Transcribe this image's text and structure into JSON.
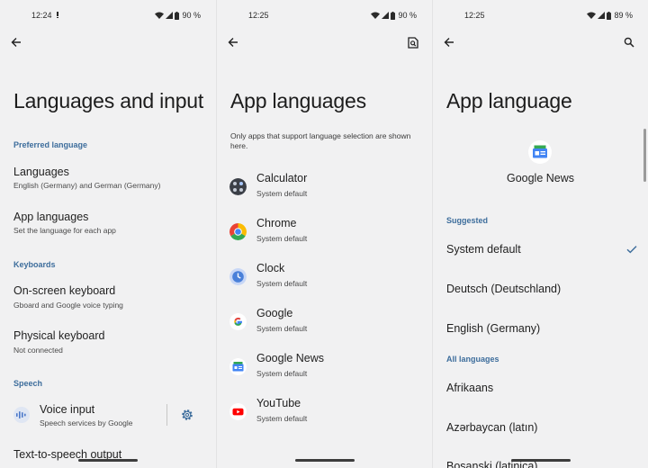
{
  "colors": {
    "accent": "#3d6d9c",
    "background": "#f1f1f2",
    "text": "#1f1f1f",
    "subtext": "#4a4a4a"
  },
  "screen1": {
    "status": {
      "time": "12:24",
      "battery": "90 %"
    },
    "title": "Languages and input",
    "preferred_header": "Preferred language",
    "languages": {
      "title": "Languages",
      "sub": "English (Germany) and German (Germany)"
    },
    "app_languages": {
      "title": "App languages",
      "sub": "Set the language for each app"
    },
    "keyboards_header": "Keyboards",
    "onscreen": {
      "title": "On-screen keyboard",
      "sub": "Gboard and Google voice typing"
    },
    "physical": {
      "title": "Physical keyboard",
      "sub": "Not connected"
    },
    "speech_header": "Speech",
    "voice_input": {
      "title": "Voice input",
      "sub": "Speech services by Google"
    },
    "tts": {
      "title": "Text-to-speech output"
    }
  },
  "screen2": {
    "status": {
      "time": "12:25",
      "battery": "90 %"
    },
    "title": "App languages",
    "description": "Only apps that support language selection are shown here.",
    "apps": [
      {
        "name": "Calculator",
        "sub": "System default",
        "icon": "calculator-icon"
      },
      {
        "name": "Chrome",
        "sub": "System default",
        "icon": "chrome-icon"
      },
      {
        "name": "Clock",
        "sub": "System default",
        "icon": "clock-icon"
      },
      {
        "name": "Google",
        "sub": "System default",
        "icon": "google-icon"
      },
      {
        "name": "Google News",
        "sub": "System default",
        "icon": "google-news-icon"
      },
      {
        "name": "YouTube",
        "sub": "System default",
        "icon": "youtube-icon"
      }
    ]
  },
  "screen3": {
    "status": {
      "time": "12:25",
      "battery": "89 %"
    },
    "title": "App language",
    "app_name": "Google News",
    "suggested_header": "Suggested",
    "suggested": [
      "System default",
      "Deutsch (Deutschland)",
      "English (Germany)"
    ],
    "selected": "System default",
    "all_header": "All languages",
    "all": [
      "Afrikaans",
      "Azərbaycan (latın)",
      "Bosanski (latinica)"
    ]
  }
}
